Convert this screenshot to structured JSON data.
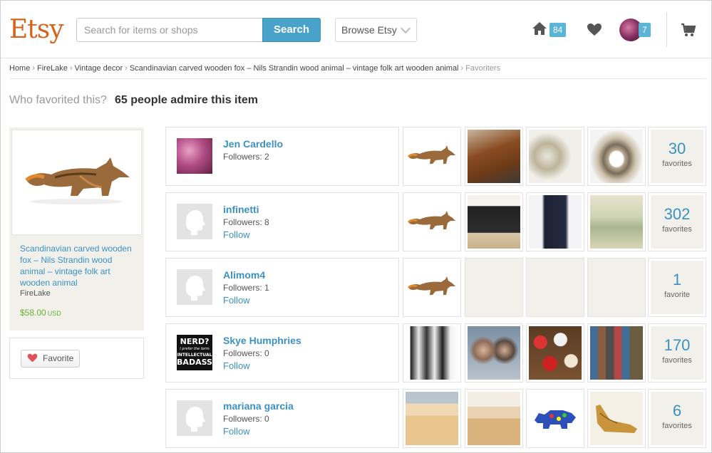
{
  "header": {
    "logo": "Etsy",
    "search_placeholder": "Search for items or shops",
    "search_button": "Search",
    "browse_label": "Browse Etsy",
    "home_badge": "84",
    "profile_badge": "7"
  },
  "breadcrumb": {
    "items": [
      "Home",
      "FireLake",
      "Vintage decor",
      "Scandinavian carved wooden fox – Nils Strandin wood animal – vintage folk art wooden animal"
    ],
    "current": "Favoriters"
  },
  "page": {
    "question": "Who favorited this?",
    "heading": "65 people admire this item"
  },
  "item": {
    "title": "Scandinavian carved wooden fox – Nils Strandin wood animal – vintage folk art wooden animal",
    "shop": "FireLake",
    "price": "$58.00",
    "currency": "USD",
    "favorite_button": "Favorite"
  },
  "users": [
    {
      "name": "Jen Cardello",
      "followers": "Followers: 2",
      "follow": "",
      "favorites": "30",
      "favorites_label": "favorites"
    },
    {
      "name": "infinetti",
      "followers": "Followers: 8",
      "follow": "Follow",
      "favorites": "302",
      "favorites_label": "favorites"
    },
    {
      "name": "Alimom4",
      "followers": "Followers: 1",
      "follow": "Follow",
      "favorites": "1",
      "favorites_label": "favorite"
    },
    {
      "name": "Skye Humphries",
      "followers": "Followers: 0",
      "follow": "Follow",
      "favorites": "170",
      "favorites_label": "favorites",
      "avatar_text": [
        "NERD?",
        "I prefer the term",
        "INTELLECTUAL",
        "BADASS"
      ]
    },
    {
      "name": "mariana garcia",
      "followers": "Followers: 0",
      "follow": "Follow",
      "favorites": "6",
      "favorites_label": "favorites"
    }
  ],
  "colors": {
    "brand": "#d5641c",
    "link": "#3a92c2",
    "search_button": "#49a2c9",
    "badge": "#5ab5d6",
    "price": "#67b030"
  }
}
